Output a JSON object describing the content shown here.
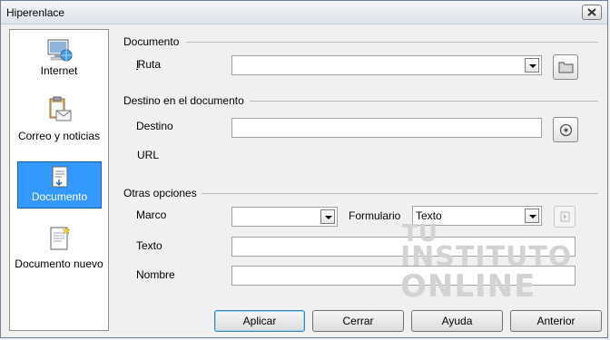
{
  "window": {
    "title": "Hiperenlace"
  },
  "sidebar": {
    "items": [
      {
        "label": "Internet",
        "icon": "globe-computer-icon"
      },
      {
        "label": "Correo y noticias",
        "icon": "mail-clipboard-icon"
      },
      {
        "label": "Documento",
        "icon": "document-icon",
        "selected": true
      },
      {
        "label": "Documento nuevo",
        "icon": "new-document-icon"
      }
    ]
  },
  "sections": {
    "documento": {
      "title": "Documento",
      "path_label": "Ruta",
      "path_value": ""
    },
    "destino": {
      "title": "Destino en el documento",
      "target_label": "Destino",
      "target_value": "",
      "url_label": "URL"
    },
    "otras": {
      "title": "Otras opciones",
      "frame_label": "Marco",
      "frame_value": "",
      "form_label": "Formulario",
      "form_value": "Texto",
      "text_label": "Texto",
      "text_value": "",
      "name_label": "Nombre",
      "name_value": ""
    }
  },
  "buttons": {
    "apply": "Aplicar",
    "close": "Cerrar",
    "help": "Ayuda",
    "back": "Anterior"
  },
  "watermark": {
    "line1": "TU",
    "line2": "INSTITUTO",
    "line3": "ONLINE"
  }
}
